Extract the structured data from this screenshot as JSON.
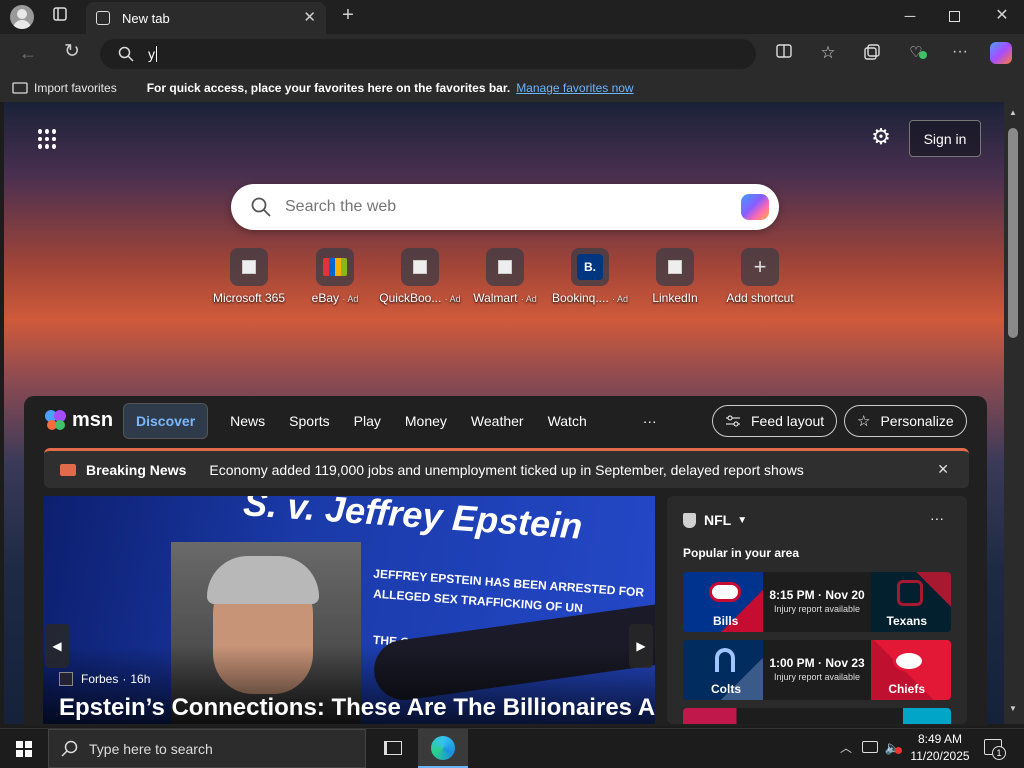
{
  "browser": {
    "tab_title": "New tab",
    "address_value": "y"
  },
  "favorites_bar": {
    "import_label": "Import favorites",
    "message": "For quick access, place your favorites here on the favorites bar.",
    "manage_link": "Manage favorites now"
  },
  "newtab": {
    "sign_in": "Sign in",
    "search_placeholder": "Search the web",
    "shortcuts": [
      {
        "label": "Microsoft 365",
        "ad": ""
      },
      {
        "label": "eBay",
        "ad": "· Ad"
      },
      {
        "label": "QuickBoo...",
        "ad": "· Ad"
      },
      {
        "label": "Walmart",
        "ad": "· Ad"
      },
      {
        "label": "Bookinq....",
        "ad": "· Ad"
      },
      {
        "label": "LinkedIn",
        "ad": ""
      },
      {
        "label": "Add shortcut",
        "ad": ""
      }
    ],
    "booking_letter": "B."
  },
  "msn": {
    "logo": "msn",
    "tabs": [
      "Discover",
      "News",
      "Sports",
      "Play",
      "Money",
      "Weather",
      "Watch"
    ],
    "more": "···",
    "feed_layout": "Feed layout",
    "personalize": "Personalize",
    "breaking_label": "Breaking News",
    "breaking_text": "Economy added 119,000 jobs and unemployment ticked up in September, delayed report shows",
    "hero": {
      "source": "Forbes",
      "age": "16h",
      "title": "Epstein’s Connections: These Are The Billionaires And",
      "sign_heading": "S. v. Jeffrey Epstein",
      "sign_bullet1a": "JEFFREY EPSTEIN HAS BEEN ARRESTED FOR",
      "sign_bullet1b": "ALLEGED SEX TRAFFICKING OF UN",
      "sign_bullet2": "THE C"
    },
    "nfl": {
      "title": "NFL",
      "subtitle": "Popular in your area",
      "games": [
        {
          "home": "Bills",
          "away": "Texans",
          "time": "8:15 PM · Nov 20",
          "note": "Injury report available",
          "home_color": "#00338d",
          "away_color": "#03202f"
        },
        {
          "home": "Colts",
          "away": "Chiefs",
          "time": "1:00 PM · Nov 23",
          "note": "Injury report available",
          "home_color": "#002c5f",
          "away_color": "#e31837"
        }
      ]
    }
  },
  "taskbar": {
    "search_placeholder": "Type here to search",
    "time": "8:49 AM",
    "date": "11/20/2025",
    "notif_count": "1"
  },
  "colors": {
    "accent": "#4ca0ff",
    "breaking": "#e06a4a"
  }
}
